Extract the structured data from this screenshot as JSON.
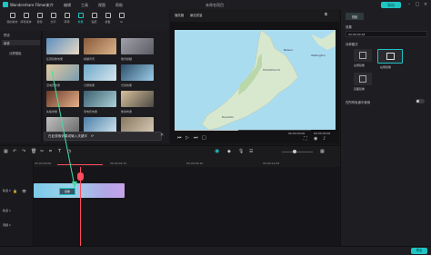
{
  "app": {
    "name": "Wondershare Filmora",
    "menu": [
      "文件",
      "编辑",
      "工具",
      "视图",
      "帮助"
    ],
    "window_title": "未命名项目",
    "export_label": "导出"
  },
  "media_tabs": [
    {
      "label": "我的素材",
      "active": false
    },
    {
      "label": "库存媒体",
      "active": false
    },
    {
      "label": "音频",
      "active": false
    },
    {
      "label": "文字",
      "active": false
    },
    {
      "label": "转场",
      "active": false
    },
    {
      "label": "效果",
      "active": true
    },
    {
      "label": "贴纸",
      "active": false
    },
    {
      "label": "模板",
      "active": false
    },
    {
      "label": "AI",
      "active": false
    }
  ],
  "left_nav": {
    "items": [
      "预设",
      "最爱",
      "分屏模板"
    ],
    "selected": "最爱"
  },
  "effects": [
    {
      "label": "任意镜像效果",
      "colors": [
        "#5b8fbf",
        "#e8d9c4"
      ]
    },
    {
      "label": "模糊背景",
      "colors": [
        "#8a5a3a",
        "#d9b48a"
      ]
    },
    {
      "label": "散景模糊",
      "colors": [
        "#a0a0a8",
        "#5c5c66"
      ]
    },
    {
      "label": "旧电影效果",
      "colors": [
        "#e2c9a0",
        "#7a9cb0"
      ]
    },
    {
      "label": "分屏效果",
      "colors": [
        "#6da9c9",
        "#d7e6ee"
      ]
    },
    {
      "label": "光线效果",
      "colors": [
        "#2e4f6b",
        "#9ccde8"
      ]
    },
    {
      "label": "失焦效果",
      "colors": [
        "#6b3b2a",
        "#e5b08a"
      ]
    },
    {
      "label": "老电影效果",
      "colors": [
        "#3b6070",
        "#aad0d8"
      ]
    },
    {
      "label": "像素效果",
      "colors": [
        "#d8c19c",
        "#4d4a44"
      ]
    },
    {
      "label": "黑白效果",
      "colors": [
        "#bfbfbf",
        "#6a6a6a"
      ]
    },
    {
      "label": "镜头光晕",
      "colors": [
        "#4c7fa7",
        "#cfe4ef"
      ]
    },
    {
      "label": "晕影效果",
      "colors": [
        "#87775f",
        "#d8cbb7"
      ]
    }
  ],
  "tooltip": {
    "text": "在此搜索效果或输入关键字",
    "close": "✕"
  },
  "preview": {
    "player_label": "播放器",
    "quality_label": "最佳质量",
    "time_current": "00:00:00:00",
    "time_total": "00:00:05:00",
    "map_city_1": "Christchurch",
    "map_city_2": "Dunedin",
    "map_city_3": "Nelson",
    "map_city_4": "Wellington"
  },
  "properties": {
    "tab_label": "视频",
    "section_title": "效果",
    "value_field": "00:00:00:18",
    "param_label": "对称模式",
    "options": [
      "左侧镜像",
      "右侧镜像",
      "双面镜像"
    ],
    "toggle_label": "在所有轨道中使用"
  },
  "timeline": {
    "ticks": [
      "00:00:00:00",
      "00:00:04:15",
      "00:00:09:10",
      "00:00:14:05",
      "00:00:19:00"
    ],
    "clip_label": "镜像",
    "track_labels": [
      "轨道 2",
      "轨道 1",
      "音频 1"
    ]
  },
  "bottom": {
    "status_label": "导出"
  },
  "colors": {
    "accent": "#1fc5c5",
    "playhead": "#ff4b5c",
    "panel_bg": "#1e1e22"
  }
}
